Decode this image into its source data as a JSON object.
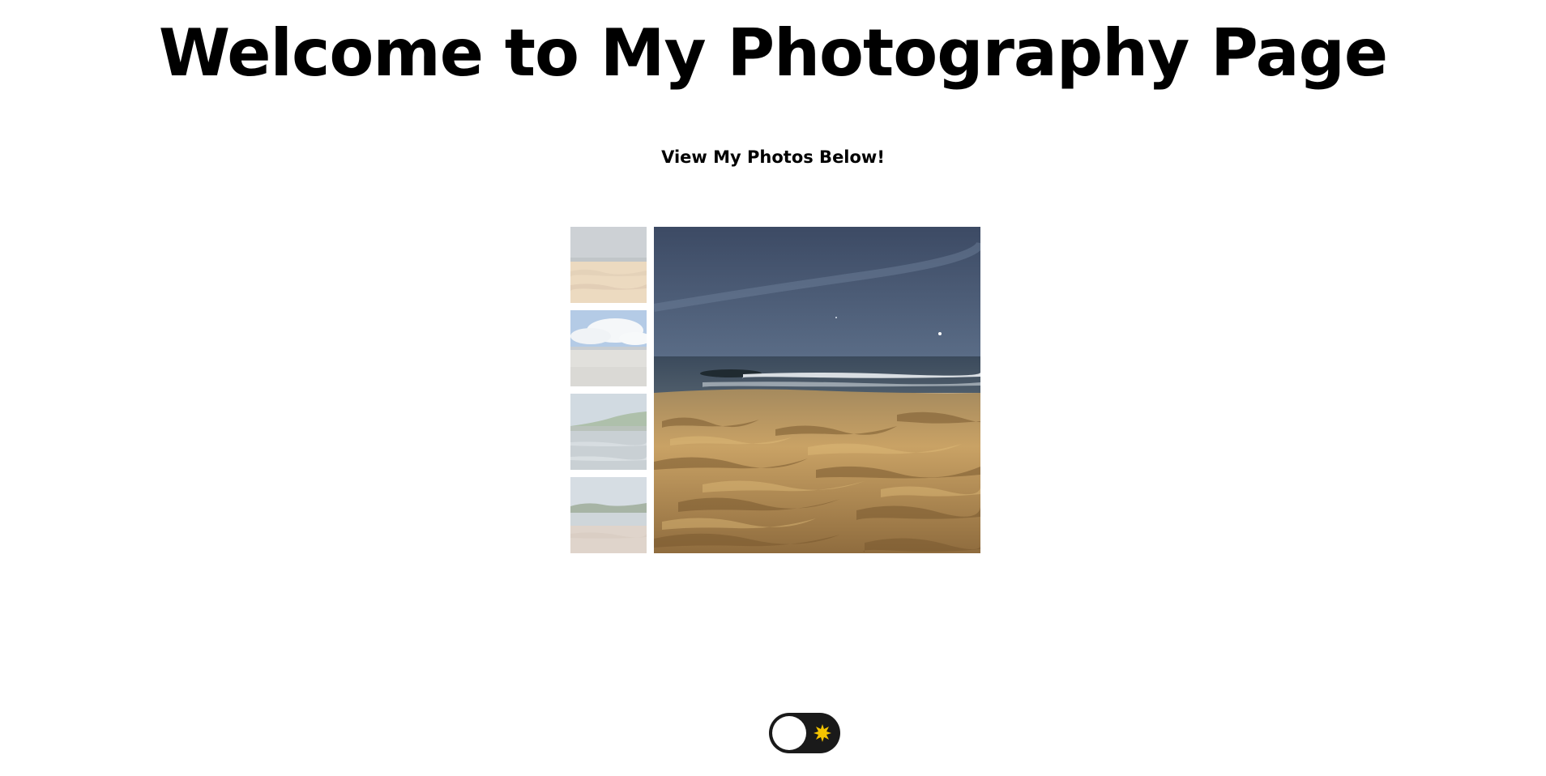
{
  "header": {
    "title": "Welcome to My Photography Page",
    "subtitle": "View My Photos Below!"
  },
  "gallery": {
    "thumbnails": [
      {
        "icon": "beach-photo-thumbnail"
      },
      {
        "icon": "clouds-beach-photo-thumbnail"
      },
      {
        "icon": "shoreline-trees-photo-thumbnail"
      },
      {
        "icon": "lake-reflection-photo-thumbnail"
      }
    ],
    "thumbnail_opacity": 0.42,
    "main_photo": {
      "icon": "night-beach-sand-photo"
    }
  },
  "theme_toggle": {
    "icon": "sun-icon",
    "state": "light",
    "track_color": "#1a1a1a",
    "sun_color": "#f5c400"
  }
}
